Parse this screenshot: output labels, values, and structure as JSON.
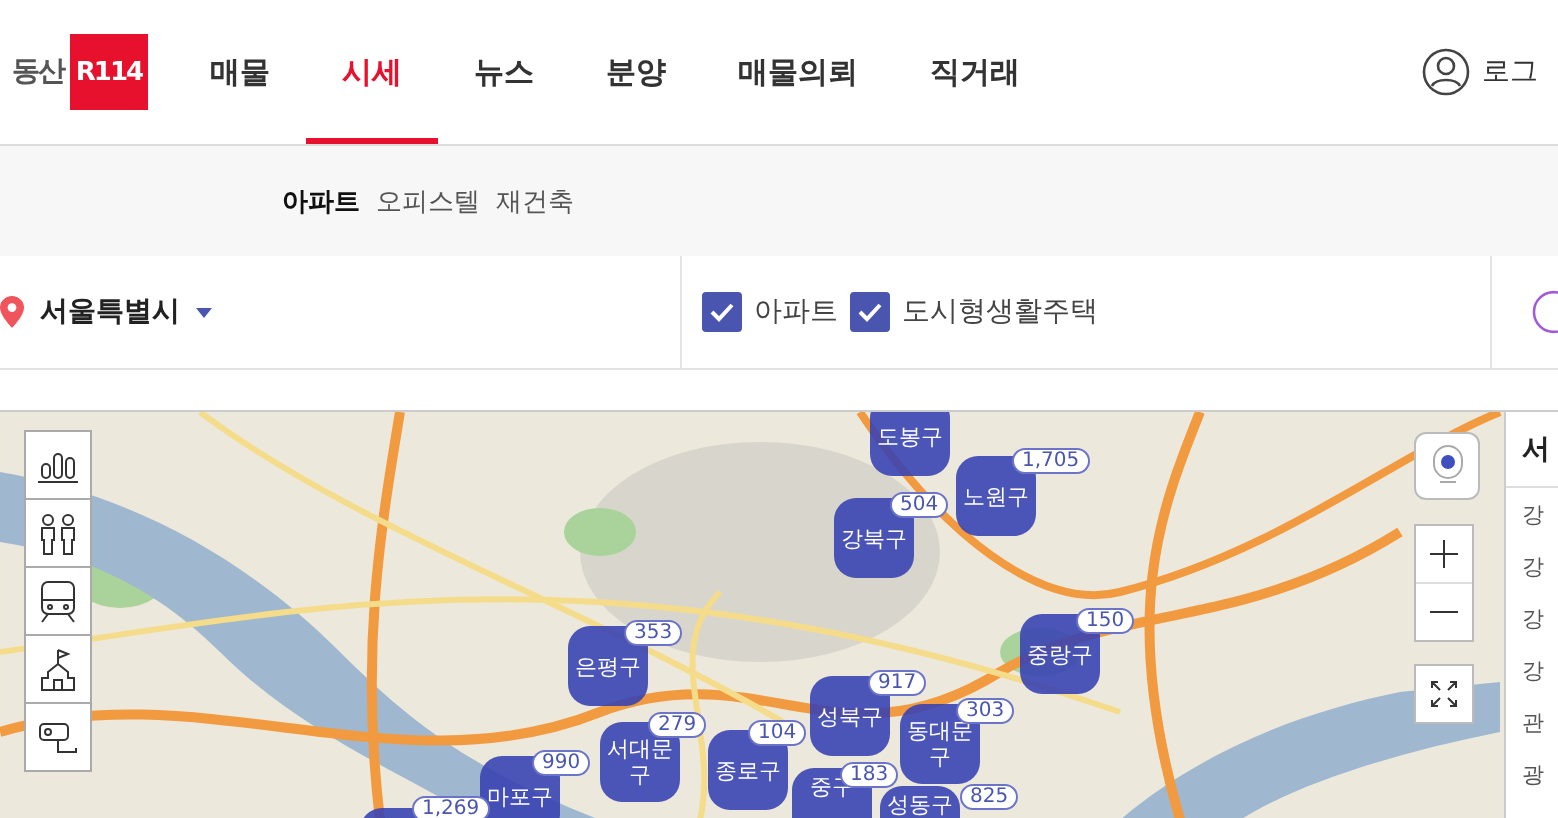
{
  "header": {
    "logo_text": "동산",
    "logo_badge": "R114",
    "nav": [
      {
        "label": "매물",
        "selected": false
      },
      {
        "label": "시세",
        "selected": true
      },
      {
        "label": "뉴스",
        "selected": false
      },
      {
        "label": "분양",
        "selected": false
      },
      {
        "label": "매물의뢰",
        "selected": false
      },
      {
        "label": "직거래",
        "selected": false
      }
    ],
    "login": "로그"
  },
  "subtabs": [
    {
      "label": "아파트",
      "selected": true
    },
    {
      "label": "오피스텔",
      "selected": false
    },
    {
      "label": "재건축",
      "selected": false
    }
  ],
  "filter": {
    "region": "서울특별시",
    "types": [
      {
        "label": "아파트",
        "checked": true
      },
      {
        "label": "도시형생활주택",
        "checked": true
      }
    ]
  },
  "map": {
    "clusters": [
      {
        "label": "도봉구"
      },
      {
        "label": "노원구",
        "count": "1,705"
      },
      {
        "label": "강북구",
        "count": "504"
      },
      {
        "label": "은평구",
        "count": "353"
      },
      {
        "label": "서대문구",
        "count": "279"
      },
      {
        "label": "마포구",
        "count": "990"
      },
      {
        "label": "종로구",
        "count": "104"
      },
      {
        "label": "성북구",
        "count": "917"
      },
      {
        "label": "중구",
        "count": "183"
      },
      {
        "label": "동대문구",
        "count": "303"
      },
      {
        "label": "성동구",
        "count": "825"
      },
      {
        "label": "중랑구",
        "count": "150"
      },
      {
        "count": "1,269"
      }
    ]
  },
  "side_panel": {
    "title": "서",
    "items": [
      "강",
      "강",
      "강",
      "강",
      "관",
      "광"
    ]
  }
}
